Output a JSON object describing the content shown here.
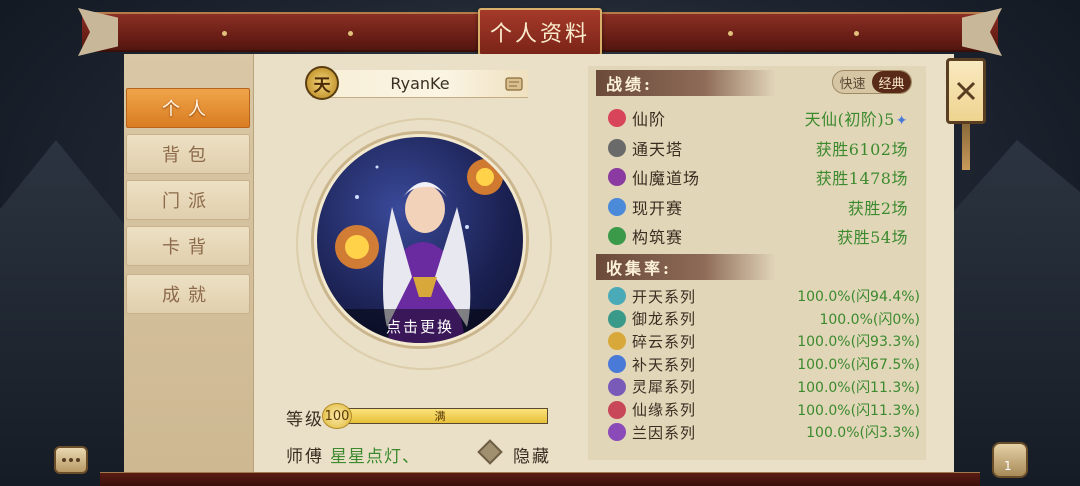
{
  "title": "个人资料",
  "sidebar": {
    "items": [
      {
        "label": "个人",
        "active": true
      },
      {
        "label": "背包",
        "active": false
      },
      {
        "label": "门派",
        "active": false
      },
      {
        "label": "卡背",
        "active": false
      },
      {
        "label": "成就",
        "active": false
      }
    ]
  },
  "profile": {
    "rank_badge": "天",
    "username": "RyanKe",
    "avatar_change_label": "点击更换",
    "level_label": "等级",
    "level_value": "100",
    "level_full_label": "满",
    "level_progress": 1.0,
    "master_label": "师傅",
    "master_name": "星星点灯、",
    "hide_label": "隐藏"
  },
  "record": {
    "heading": "战绩:",
    "toggle": {
      "options": [
        "快速",
        "经典"
      ],
      "selected": "经典"
    },
    "rows": [
      {
        "name": "仙阶",
        "value": "天仙(初阶)5",
        "icon": "star-icon",
        "color": "#d8445a",
        "extra_icon": "✦"
      },
      {
        "name": "通天塔",
        "value": "获胜6102场",
        "icon": "tower-icon",
        "color": "#6a6a6a"
      },
      {
        "name": "仙魔道场",
        "value": "获胜1478场",
        "icon": "arena-icon",
        "color": "#8a3aa0"
      },
      {
        "name": "现开赛",
        "value": "获胜2场",
        "icon": "cards-icon",
        "color": "#4a8ad8"
      },
      {
        "name": "构筑赛",
        "value": "获胜54场",
        "icon": "build-icon",
        "color": "#3a9a4a"
      }
    ]
  },
  "collection": {
    "heading": "收集率:",
    "rows": [
      {
        "name": "开天系列",
        "value": "100.0%(闪94.4%)",
        "icon": "series-icon",
        "color": "#4aaab8"
      },
      {
        "name": "御龙系列",
        "value": "100.0%(闪0%)",
        "icon": "dragon-icon",
        "color": "#3a9a8a"
      },
      {
        "name": "碎云系列",
        "value": "100.0%(闪93.3%)",
        "icon": "cloud-icon",
        "color": "#d8a83a"
      },
      {
        "name": "补天系列",
        "value": "100.0%(闪67.5%)",
        "icon": "sky-icon",
        "color": "#4a7ad8"
      },
      {
        "name": "灵犀系列",
        "value": "100.0%(闪11.3%)",
        "icon": "spirit-icon",
        "color": "#7a5ab8"
      },
      {
        "name": "仙缘系列",
        "value": "100.0%(闪11.3%)",
        "icon": "fate-icon",
        "color": "#c8485a"
      },
      {
        "name": "兰因系列",
        "value": "100.0%(闪3.3%)",
        "icon": "orchid-icon",
        "color": "#8a4ab8"
      }
    ]
  },
  "bag_count": "1"
}
